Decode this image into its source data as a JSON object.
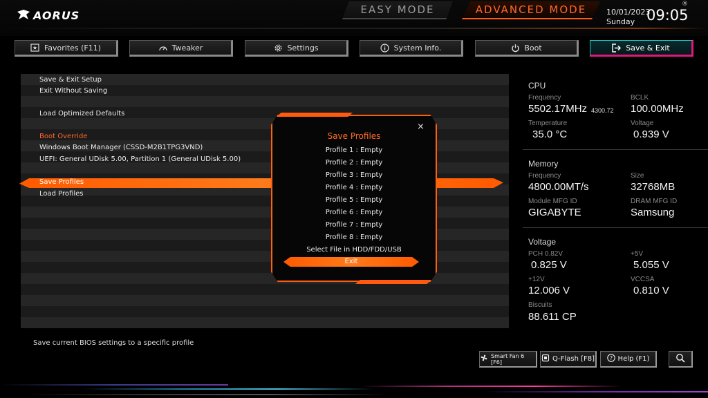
{
  "brand": {
    "logo_text": "AORUS"
  },
  "modes": {
    "easy": "EASY MODE",
    "advanced": "ADVANCED MODE"
  },
  "clock": {
    "date": "10/01/2023",
    "day": "Sunday",
    "time": "09:05",
    "reg": "®"
  },
  "tabs": [
    {
      "label": "Favorites (F11)",
      "icon": "favorites-icon",
      "active": false
    },
    {
      "label": "Tweaker",
      "icon": "speedometer-icon",
      "active": false
    },
    {
      "label": "Settings",
      "icon": "gear-icon",
      "active": false
    },
    {
      "label": "System Info.",
      "icon": "info-icon",
      "active": false
    },
    {
      "label": "Boot",
      "icon": "power-icon",
      "active": false
    },
    {
      "label": "Save & Exit",
      "icon": "exit-icon",
      "active": true
    }
  ],
  "menu": {
    "save_exit_setup": "Save & Exit Setup",
    "exit_without_saving": "Exit Without Saving",
    "load_optimized_defaults": "Load Optimized Defaults",
    "boot_override_header": "Boot Override",
    "windows_boot_manager": "Windows Boot Manager (CSSD-M2B1TPG3VND)",
    "uefi_udisk": "UEFI: General UDisk 5.00, Partition 1 (General UDisk 5.00)",
    "save_profiles": "Save Profiles",
    "load_profiles": "Load Profiles"
  },
  "modal": {
    "title": "Save Profiles",
    "close": "×",
    "items": [
      "Profile 1 : Empty",
      "Profile 2 : Empty",
      "Profile 3 : Empty",
      "Profile 4 : Empty",
      "Profile 5 : Empty",
      "Profile 6 : Empty",
      "Profile 7 : Empty",
      "Profile 8 : Empty",
      "Select File in HDD/FDD/USB"
    ],
    "exit": "Exit"
  },
  "cpu": {
    "head": "CPU",
    "frequency_label": "Frequency",
    "frequency": "5502.17MHz",
    "frequency_sub": "4300.72",
    "bclk_label": "BCLK",
    "bclk": "100.00MHz",
    "temperature_label": "Temperature",
    "temperature": "35.0 °C",
    "voltage_label": "Voltage",
    "voltage": "0.939 V"
  },
  "memory": {
    "head": "Memory",
    "frequency_label": "Frequency",
    "frequency": "4800.00MT/s",
    "size_label": "Size",
    "size": "32768MB",
    "module_mfg_label": "Module MFG ID",
    "module_mfg": "GIGABYTE",
    "dram_mfg_label": "DRAM MFG ID",
    "dram_mfg": "Samsung"
  },
  "voltage": {
    "head": "Voltage",
    "pch_label": "PCH 0.82V",
    "pch": "0.825 V",
    "p5v_label": "+5V",
    "p5v": "5.055 V",
    "p12v_label": "+12V",
    "p12v": "12.006 V",
    "vccsa_label": "VCCSA",
    "vccsa": "0.810 V",
    "biscuits_label": "Biscuits",
    "biscuits": "88.611 CP"
  },
  "status_text": "Save current BIOS settings to a specific profile",
  "footer": {
    "smart_fan": "Smart Fan 6 [F6]",
    "qflash": "Q-Flash [F8]",
    "help": "Help (F1)"
  },
  "colors": {
    "accent": "#ff6a2a",
    "active_tab_cyan": "#1fc8c8",
    "active_tab_magenta": "#e0187e"
  }
}
